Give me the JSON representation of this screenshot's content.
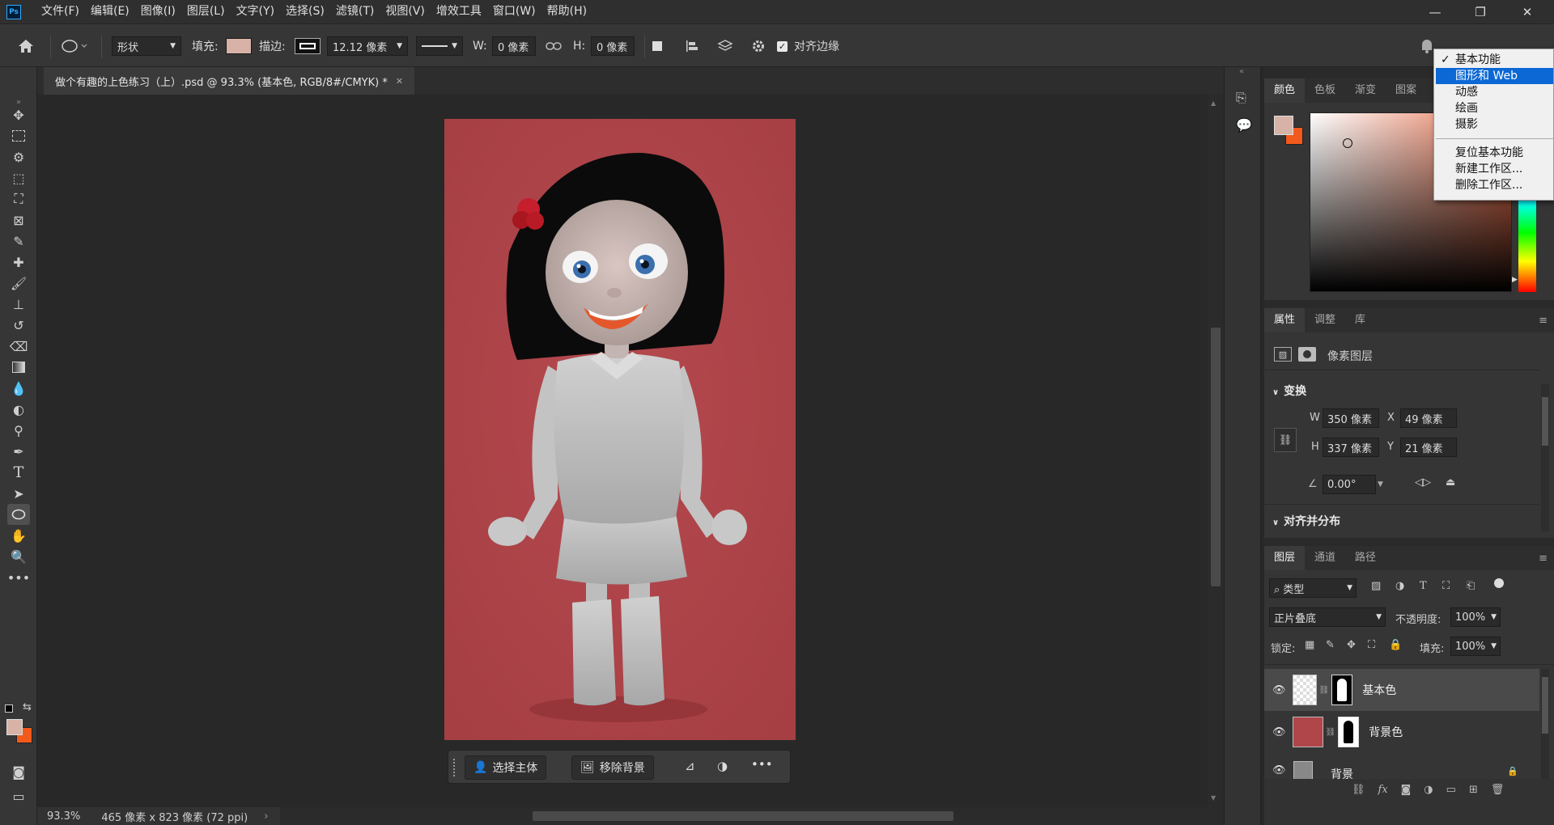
{
  "app": {
    "logo": "Ps"
  },
  "menubar": {
    "items": [
      "文件(F)",
      "编辑(E)",
      "图像(I)",
      "图层(L)",
      "文字(Y)",
      "选择(S)",
      "滤镜(T)",
      "视图(V)",
      "增效工具",
      "窗口(W)",
      "帮助(H)"
    ],
    "window_buttons": {
      "minimize": "—",
      "restore": "❐",
      "close": "✕"
    }
  },
  "options_bar": {
    "mode": "形状",
    "fill_label": "填充:",
    "fill_color": "#d8b2a6",
    "stroke_label": "描边:",
    "stroke_width": "12.12 像素",
    "w_label": "W:",
    "w_value": "0 像素",
    "h_label": "H:",
    "h_value": "0 像素",
    "align_edges_label": "对齐边缘",
    "align_edges_checked": true
  },
  "document": {
    "tab_title": "做个有趣的上色练习（上）.psd @ 93.3% (基本色, RGB/8#/CMYK) *",
    "background_color": "#b0454a"
  },
  "context_bar": {
    "select_subject": "选择主体",
    "remove_background": "移除背景"
  },
  "status_bar": {
    "zoom": "93.3%",
    "doc_size": "465 像素 x 823 像素 (72 ppi)"
  },
  "color_panel": {
    "tabs": [
      "颜色",
      "色板",
      "渐变",
      "图案"
    ],
    "foreground": "#d8b2a6",
    "background": "#f25a1c",
    "field_hue_color": "#e8714f"
  },
  "workspace_menu": {
    "items": [
      {
        "label": "基本功能",
        "checked": true,
        "highlighted": false
      },
      {
        "label": "图形和 Web",
        "checked": false,
        "highlighted": true
      },
      {
        "label": "动感",
        "checked": false,
        "highlighted": false
      },
      {
        "label": "绘画",
        "checked": false,
        "highlighted": false
      },
      {
        "label": "摄影",
        "checked": false,
        "highlighted": false
      }
    ],
    "actions": [
      "复位基本功能",
      "新建工作区...",
      "删除工作区..."
    ]
  },
  "properties_panel": {
    "tabs": [
      "属性",
      "调整",
      "库"
    ],
    "layer_kind": "像素图层",
    "transform_title": "变换",
    "w_label": "W",
    "w": "350 像素",
    "x_label": "X",
    "x": "49 像素",
    "h_label": "H",
    "h": "337 像素",
    "y_label": "Y",
    "y": "21 像素",
    "angle": "0.00°",
    "align_title": "对齐并分布"
  },
  "layers_panel": {
    "tabs": [
      "图层",
      "通道",
      "路径"
    ],
    "filter_type": "类型",
    "blend_mode": "正片叠底",
    "opacity_label": "不透明度:",
    "opacity": "100%",
    "lock_label": "锁定:",
    "fill_label": "填充:",
    "fill": "100%",
    "layers": [
      {
        "name": "基本色",
        "selected": true,
        "thumb_color": "#e8e8e8"
      },
      {
        "name": "背景色",
        "selected": false,
        "thumb_color": "#b0454a"
      },
      {
        "name": "背景",
        "selected": false,
        "thumb_color": "#888888"
      }
    ]
  }
}
